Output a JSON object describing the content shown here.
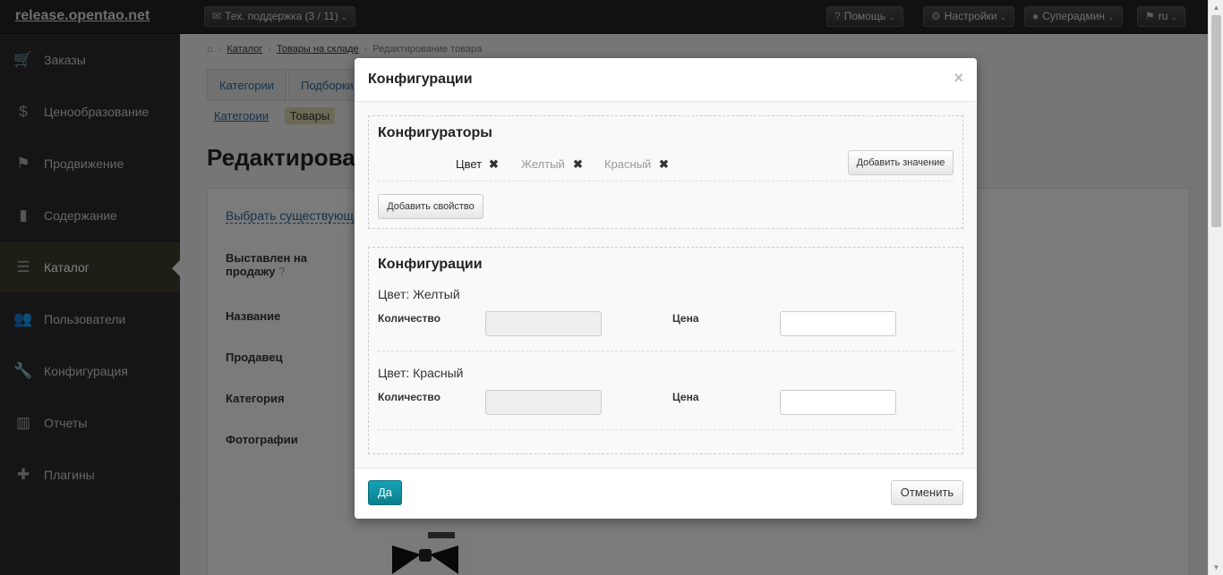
{
  "topbar": {
    "brand": "release.opentao.net",
    "support": "Тех. поддержка (3 / 11)",
    "help": "Помощь",
    "settings": "Настройки",
    "user": "Суперадмин",
    "lang": "ru"
  },
  "sidebar": {
    "items": [
      {
        "label": "Заказы",
        "icon": "cart-icon"
      },
      {
        "label": "Ценообразование",
        "icon": "dollar-icon"
      },
      {
        "label": "Продвижение",
        "icon": "flag-icon"
      },
      {
        "label": "Содержание",
        "icon": "file-icon"
      },
      {
        "label": "Каталог",
        "icon": "list-icon"
      },
      {
        "label": "Пользователи",
        "icon": "users-icon"
      },
      {
        "label": "Конфигурация",
        "icon": "wrench-icon"
      },
      {
        "label": "Отчеты",
        "icon": "chart-icon"
      },
      {
        "label": "Плагины",
        "icon": "puzzle-icon"
      }
    ],
    "active_index": 4
  },
  "main": {
    "breadcrumb": {
      "catalog": "Каталог",
      "goods": "Товары на складе",
      "current": "Редактирование товара"
    },
    "tabs": [
      "Категории",
      "Подборки"
    ],
    "subtabs": {
      "link": "Категории",
      "active": "Товары"
    },
    "page_title": "Редактирова",
    "choose_link": "Выбрать существующ",
    "fields": {
      "for_sale_line1": "Выставлен на",
      "for_sale_line2": "продажу",
      "name": "Название",
      "seller": "Продавец",
      "category": "Категория",
      "photos": "Фотографии"
    }
  },
  "modal": {
    "title": "Конфигурации",
    "close": "×",
    "configurators": {
      "title": "Конфигураторы",
      "property": "Цвет",
      "values": [
        "Желтый",
        "Красный"
      ],
      "add_value": "Добавить значение",
      "add_property": "Добавить свойство"
    },
    "configurations": {
      "title": "Конфигурации",
      "items": [
        {
          "name": "Цвет: Желтый",
          "qty_label": "Количество",
          "qty_value": "",
          "price_label": "Цена",
          "price_value": ""
        },
        {
          "name": "Цвет: Красный",
          "qty_label": "Количество",
          "qty_value": "",
          "price_label": "Цена",
          "price_value": ""
        }
      ]
    },
    "footer": {
      "yes": "Да",
      "cancel": "Отменить"
    }
  }
}
